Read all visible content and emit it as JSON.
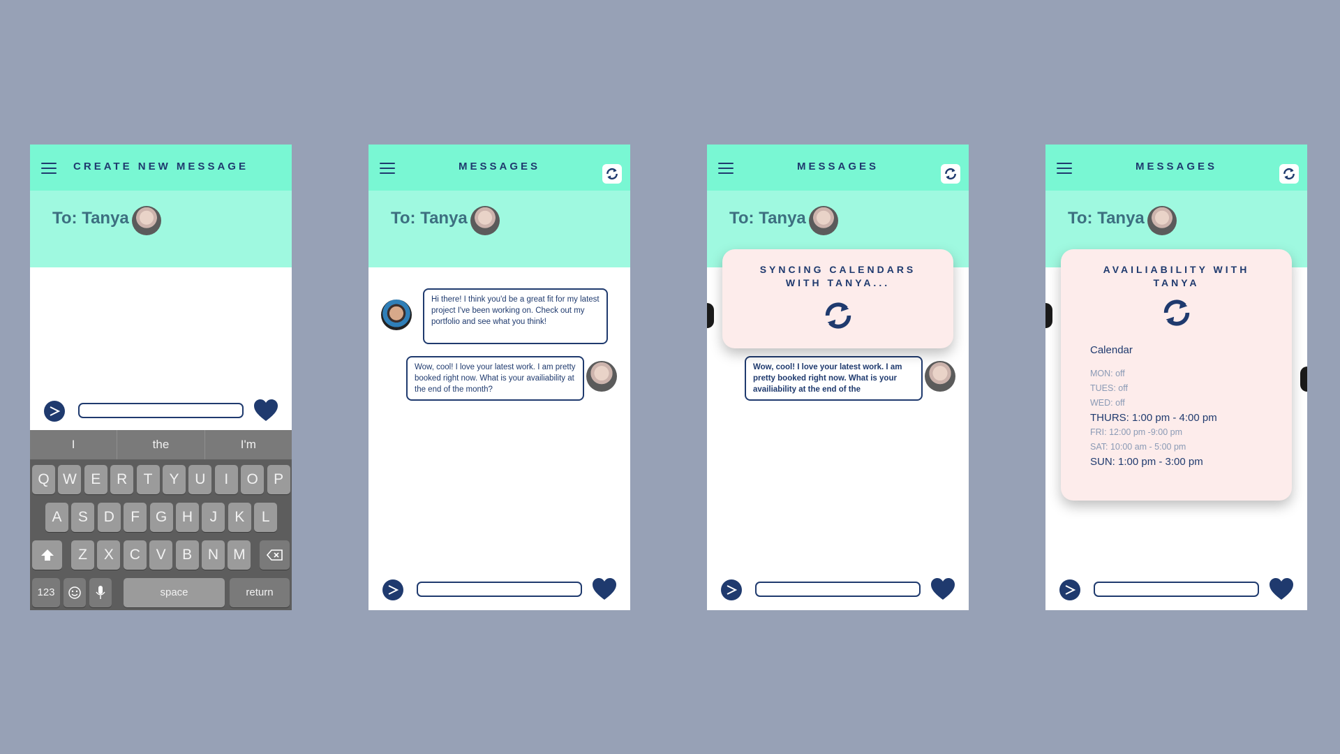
{
  "colors": {
    "background": "#97a1b6",
    "header": "#79f7d3",
    "to_area": "#9ff9e0",
    "accent": "#1f3a6e",
    "popup": "#fdeceb",
    "keyboard": "#5d5d5d"
  },
  "icons": [
    "hamburger-icon",
    "sync-icon",
    "send-icon",
    "heart-icon",
    "shift-icon",
    "backspace-icon",
    "emoji-icon",
    "microphone-icon"
  ],
  "screens": [
    {
      "header_title": "CREATE NEW MESSAGE",
      "to_label": "To: Tanya",
      "keyboard": {
        "suggestions": [
          "I",
          "the",
          "I'm"
        ],
        "row1": [
          "Q",
          "W",
          "E",
          "R",
          "T",
          "Y",
          "U",
          "I",
          "O",
          "P"
        ],
        "row2": [
          "A",
          "S",
          "D",
          "F",
          "G",
          "H",
          "J",
          "K",
          "L"
        ],
        "row3": [
          "Z",
          "X",
          "C",
          "V",
          "B",
          "N",
          "M"
        ],
        "numbers_key": "123",
        "space_key": "space",
        "return_key": "return"
      }
    },
    {
      "header_title": "MESSAGES",
      "to_label": "To: Tanya",
      "messages": [
        "Hi there! I think you'd be a great fit for my latest project I've been working on. Check out my portfolio and see what you think!",
        "Wow, cool! I love your latest work.  I am pretty booked right now. What is your availiability at the end of the month?"
      ]
    },
    {
      "header_title": "MESSAGES",
      "to_label": "To: Tanya",
      "popup_title": "SYNCING CALENDARS WITH TANYA...",
      "reply": "Wow, cool! I love your latest work.  I am pretty booked right now. What is your availiability at the end of the"
    },
    {
      "header_title": "MESSAGES",
      "to_label": "To: Tanya",
      "popup_title": "AVAILIABILITY WITH TANYA",
      "calendar_label": "Calendar",
      "calendar": [
        {
          "text": "MON: off",
          "highlight": false
        },
        {
          "text": "TUES: off",
          "highlight": false
        },
        {
          "text": "WED: off",
          "highlight": false
        },
        {
          "text": "THURS:  1:00 pm - 4:00 pm",
          "highlight": true
        },
        {
          "text": "FRI: 12:00 pm -9:00 pm",
          "highlight": false
        },
        {
          "text": "SAT: 10:00 am - 5:00 pm",
          "highlight": false
        },
        {
          "text": "SUN: 1:00 pm - 3:00 pm",
          "highlight": true
        }
      ]
    }
  ]
}
